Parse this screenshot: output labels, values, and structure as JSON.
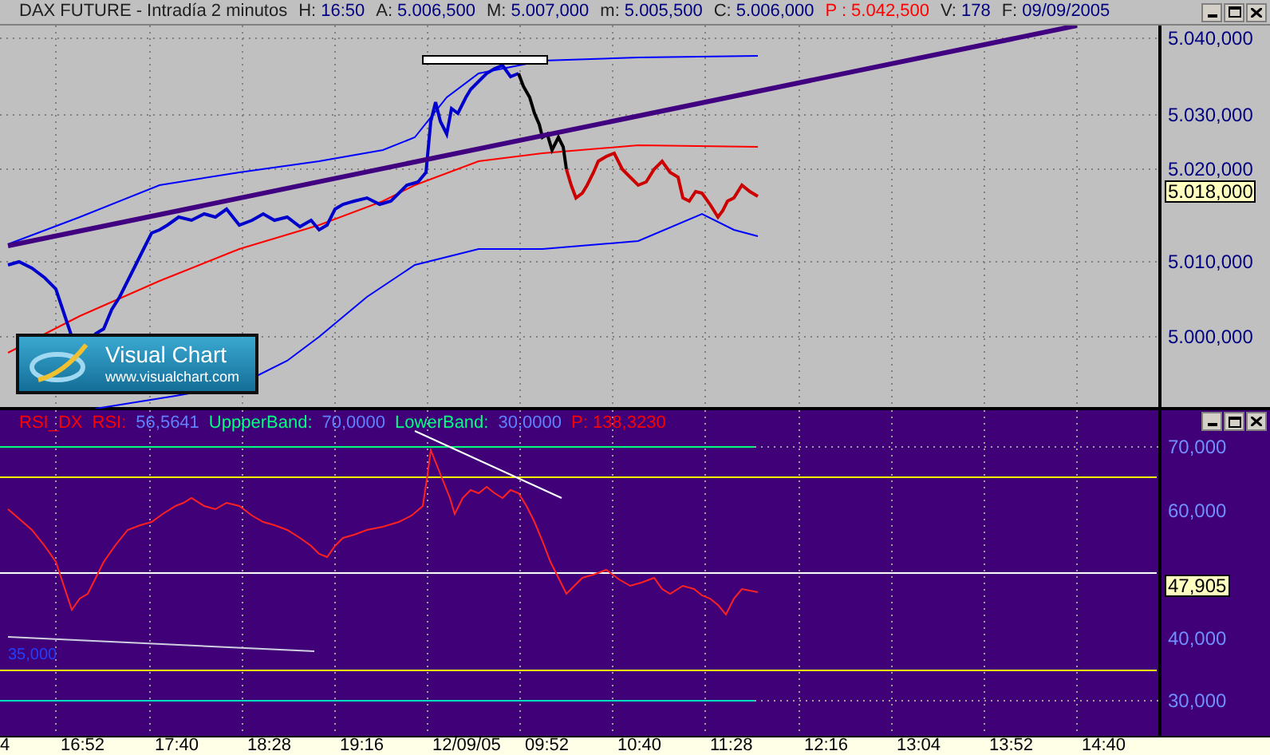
{
  "header": {
    "title": "DAX FUTURE - Intradía 2 minutos",
    "fields": [
      {
        "label": "H:",
        "value": "16:50",
        "kind": "normal"
      },
      {
        "label": "A:",
        "value": "5.006,500",
        "kind": "normal"
      },
      {
        "label": "M:",
        "value": "5.007,000",
        "kind": "normal"
      },
      {
        "label": "m:",
        "value": "5.005,500",
        "kind": "normal"
      },
      {
        "label": "C:",
        "value": "5.006,000",
        "kind": "normal"
      },
      {
        "label": "P :",
        "value": "5.042,500",
        "kind": "alert"
      },
      {
        "label": "V:",
        "value": "178",
        "kind": "normal"
      },
      {
        "label": "F:",
        "value": "09/09/2005",
        "kind": "normal"
      }
    ]
  },
  "price_panel": {
    "axis_labels": [
      "5.040,000",
      "5.030,000",
      "5.020,000",
      "5.010,000",
      "5.000,000"
    ],
    "last_price": "5.018,000",
    "logo": {
      "title": "Visual Chart",
      "url": "www.visualchart.com"
    }
  },
  "rsi_panel": {
    "legend": [
      {
        "text": "RSI_DX",
        "color": "#ff0000"
      },
      {
        "text": "RSI:",
        "color": "#ff0000"
      },
      {
        "text": "56,5641",
        "color": "#6080ff"
      },
      {
        "text": "UppperBand:",
        "color": "#00ff80"
      },
      {
        "text": "70,0000",
        "color": "#6080ff"
      },
      {
        "text": "LowerBand:",
        "color": "#00ff80"
      },
      {
        "text": "30,0000",
        "color": "#6080ff"
      },
      {
        "text": "P: 138,3230",
        "color": "#ff0000"
      }
    ],
    "axis_labels": [
      "70,000",
      "60,000",
      "40,000",
      "30,000"
    ],
    "last_value": "47,905",
    "band_label": "35,000"
  },
  "time_axis": [
    "4",
    "16:52",
    "17:40",
    "18:28",
    "19:16",
    "12/09/05",
    "09:52",
    "10:40",
    "11:28",
    "12:16",
    "13:04",
    "13:52",
    "14:40"
  ]
}
